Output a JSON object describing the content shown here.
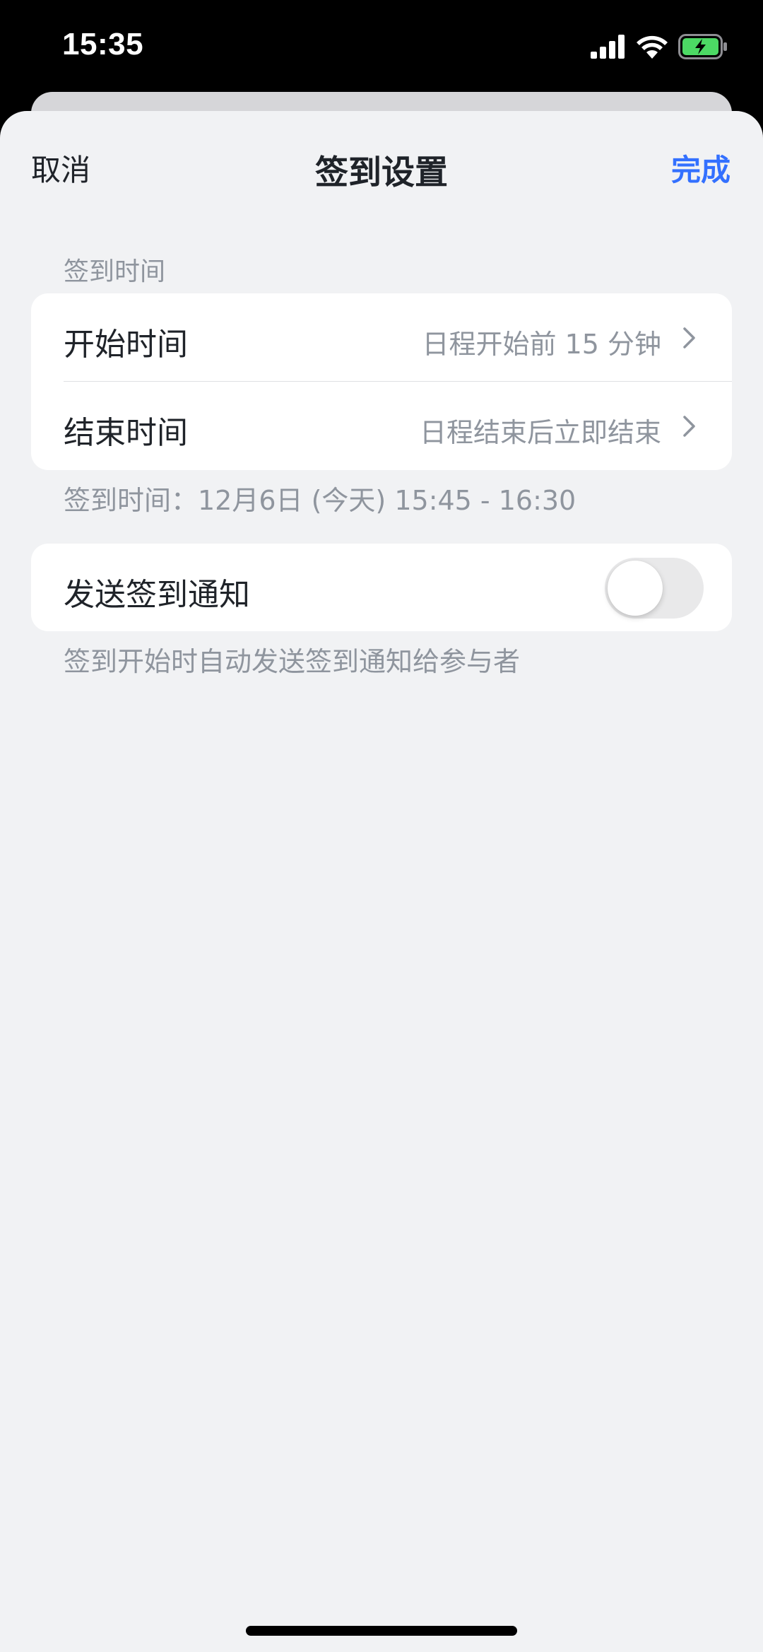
{
  "status_bar": {
    "time": "15:35",
    "icons": [
      "signal-icon",
      "wifi-icon",
      "battery-charging-icon"
    ],
    "battery_color": "#4cd964"
  },
  "nav": {
    "cancel_label": "取消",
    "title": "签到设置",
    "done_label": "完成"
  },
  "checkin_time_section": {
    "header": "签到时间",
    "rows": [
      {
        "label": "开始时间",
        "value": "日程开始前 15 分钟"
      },
      {
        "label": "结束时间",
        "value": "日程结束后立即结束"
      }
    ],
    "footer": "签到时间：12月6日 (今天) 15:45 - 16:30"
  },
  "notify_section": {
    "label": "发送签到通知",
    "toggle_on": false,
    "footer": "签到开始时自动发送签到通知给参与者"
  },
  "colors": {
    "accent": "#3370ff",
    "background": "#f1f2f4",
    "secondary_text": "#8f959e",
    "primary_text": "#1f2329"
  }
}
